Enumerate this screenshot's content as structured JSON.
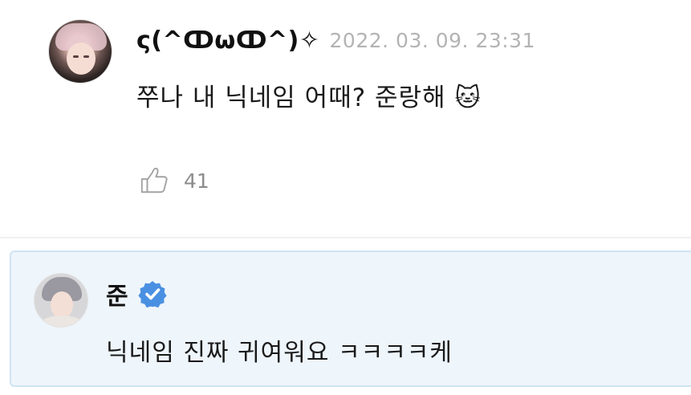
{
  "comment": {
    "author": "ς(^ↀωↀ^)✧",
    "timestamp": "2022. 03. 09. 23:31",
    "text": "쭈나 내 닉네임 어때? 준랑해 🐱",
    "likes": "41"
  },
  "reply": {
    "author": "준",
    "verified": true,
    "text": "닉네임 진짜 귀여워요 ㅋㅋㅋㅋ케"
  },
  "colors": {
    "reply_background": "#eef5fb",
    "reply_border": "#cfe4f3",
    "verified_badge": "#4a90e2",
    "timestamp": "#b3b3b3"
  },
  "icons": {
    "like": "thumbs-up-outline-icon",
    "verified": "verified-badge-icon"
  }
}
